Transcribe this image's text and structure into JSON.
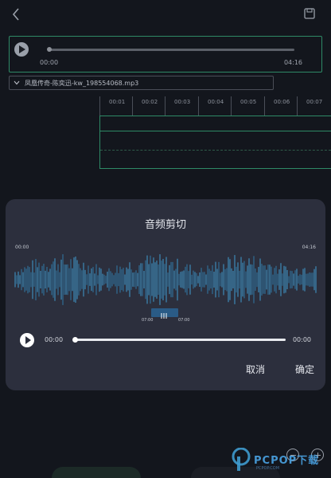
{
  "topbar": {
    "back_icon": "chevron-left-icon",
    "save_icon": "save-icon"
  },
  "player": {
    "current_time": "00:00",
    "total_time": "04:16",
    "progress": 0
  },
  "file": {
    "name": "凤凰传奇-陈奕迅-kw_198554068.mp3"
  },
  "timeline": {
    "ticks": [
      "00:01",
      "00:02",
      "00:03",
      "00:04",
      "00:05",
      "00:06",
      "00:07"
    ]
  },
  "dialog": {
    "title": "音频剪切",
    "wave_start": "00:00",
    "wave_end": "04:16",
    "selection_start": "07:00",
    "selection_end": "07:00",
    "current_time": "00:00",
    "total_time": "00:00",
    "cancel_label": "取消",
    "ok_label": "确定"
  },
  "watermark": {
    "brand": "PCPOP下载",
    "sub": "PCPOP.COM"
  },
  "colors": {
    "accent": "#2e8a66",
    "wave": "#3f9bcf",
    "dialog_bg": "#2c2f3d",
    "page_bg": "#13161d"
  }
}
